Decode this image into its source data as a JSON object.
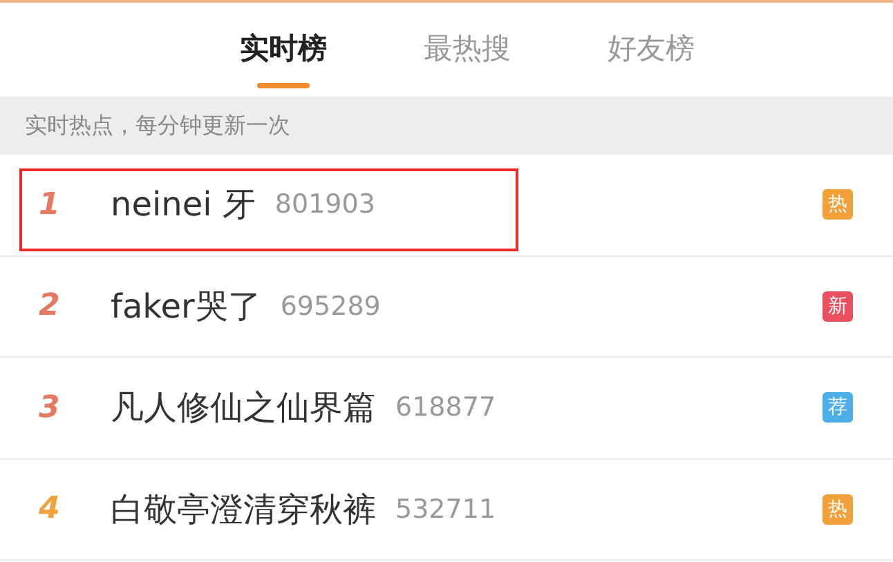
{
  "tabs": [
    {
      "label": "实时榜",
      "selected": true
    },
    {
      "label": "最热搜",
      "selected": false
    },
    {
      "label": "好友榜",
      "selected": false
    }
  ],
  "notice": "实时热点，每分钟更新一次",
  "rows": [
    {
      "rank": {
        "text": "1",
        "color": "#e57a63"
      },
      "title": "neinei 牙",
      "count": "801903",
      "badge": {
        "label": "热",
        "color": "#f2a13a"
      },
      "highlighted": true
    },
    {
      "rank": {
        "text": "2",
        "color": "#e57a63"
      },
      "title": "faker哭了",
      "count": "695289",
      "badge": {
        "label": "新",
        "color": "#e8505f"
      },
      "highlighted": false
    },
    {
      "rank": {
        "text": "3",
        "color": "#e57a63"
      },
      "title": "凡人修仙之仙界篇",
      "count": "618877",
      "badge": {
        "label": "荐",
        "color": "#4daee8"
      },
      "highlighted": false
    },
    {
      "rank": {
        "text": "4",
        "color": "#f0a23c"
      },
      "title": "白敬亭澄清穿秋裤",
      "count": "532711",
      "badge": {
        "label": "热",
        "color": "#f2a13a"
      },
      "highlighted": false
    }
  ]
}
